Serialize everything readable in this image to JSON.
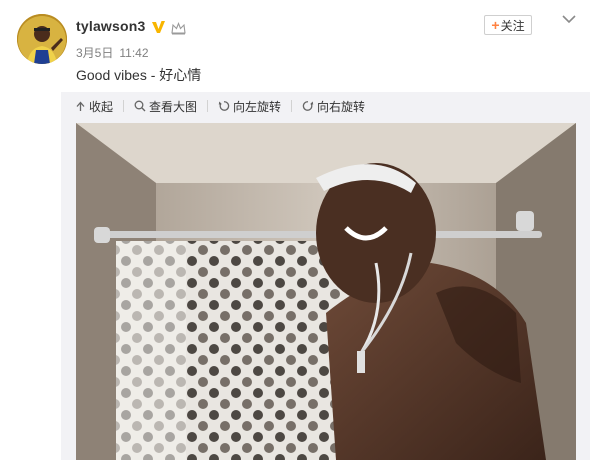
{
  "user": {
    "name": "tylawson3",
    "verified_icon": "verified-v-icon",
    "member_icon": "crown-icon"
  },
  "post": {
    "date": "3月5日",
    "time": "11:42",
    "text": "Good vibes - 好心情"
  },
  "follow_button": {
    "icon": "+",
    "label": "关注"
  },
  "menu_icon": "chevron-down-icon",
  "toolbar": {
    "collapse": "收起",
    "view_large": "查看大图",
    "rotate_left": "向左旋转",
    "rotate_right": "向右旋转"
  },
  "colors": {
    "accent": "#ff8140",
    "verified": "#f8b500",
    "toolbar_bg": "#f2f2f5"
  }
}
